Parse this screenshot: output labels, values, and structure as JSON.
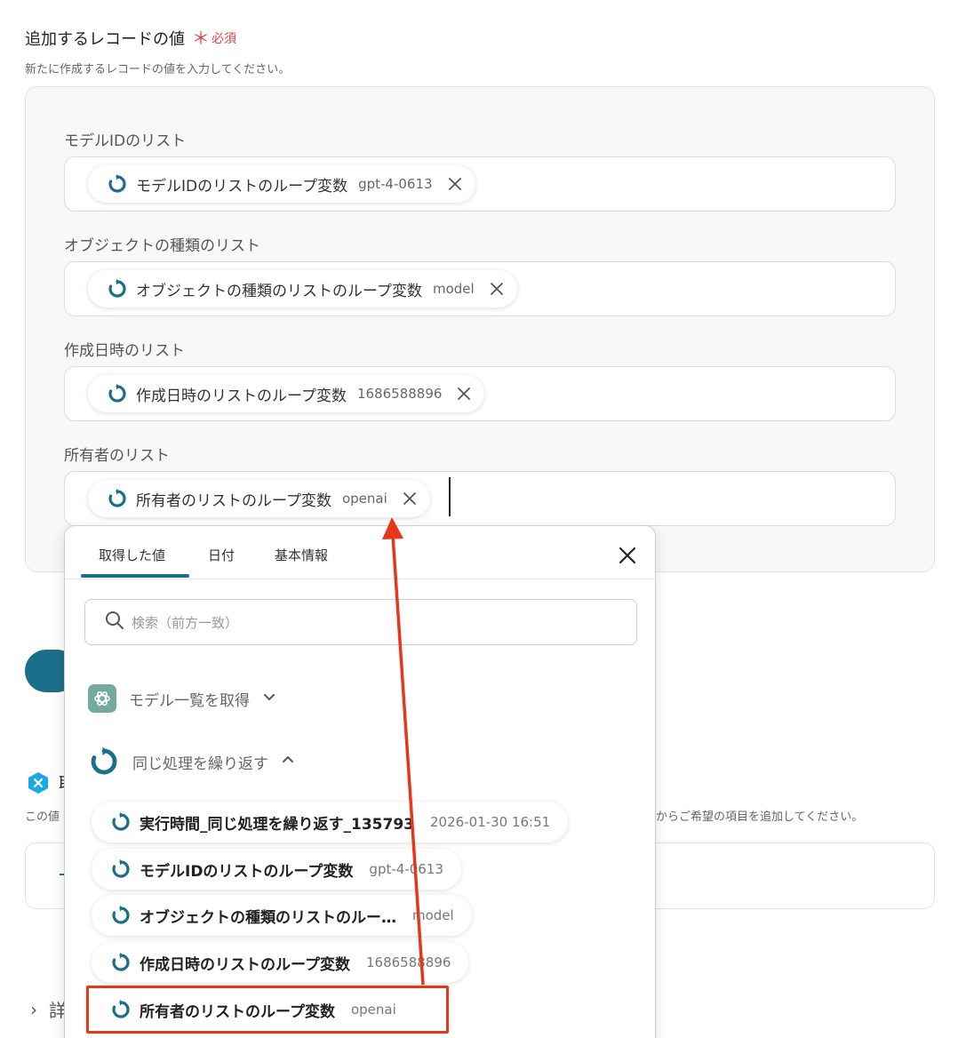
{
  "section": {
    "title": "追加するレコードの値",
    "required_mark": "＊",
    "required_label": "必須",
    "description": "新たに作成するレコードの値を入力してください。"
  },
  "fields": [
    {
      "label": "モデルIDのリスト",
      "chip_label": "モデルIDのリストのループ変数",
      "chip_value": "gpt-4-0613"
    },
    {
      "label": "オブジェクトの種類のリスト",
      "chip_label": "オブジェクトの種類のリストのループ変数",
      "chip_value": "model"
    },
    {
      "label": "作成日時のリスト",
      "chip_label": "作成日時のリストのループ変数",
      "chip_value": "1686588896"
    },
    {
      "label": "所有者のリスト",
      "chip_label": "所有者のリストのループ変数",
      "chip_value": "openai"
    }
  ],
  "background": {
    "title_fragment": "取",
    "desc_left": "この値",
    "desc_right": "からご希望の項目を追加してください。",
    "detail_chevron": "›",
    "detail_fragment": "詳"
  },
  "popup": {
    "tabs": [
      "取得した値",
      "日付",
      "基本情報"
    ],
    "active_tab": 0,
    "search_placeholder": "検索（前方一致）",
    "groups": [
      {
        "name": "モデル一覧を取得",
        "icon": "openai-icon",
        "expanded": false
      },
      {
        "name": "同じ処理を繰り返す",
        "icon": "loop-icon",
        "expanded": true
      }
    ],
    "items": [
      {
        "label": "実行時間_同じ処理を繰り返す_135793",
        "value": "2026-01-30 16:51"
      },
      {
        "label": "モデルIDのリストのループ変数",
        "value": "gpt-4-0613"
      },
      {
        "label": "オブジェクトの種類のリストのルー…",
        "value": "model"
      },
      {
        "label": "作成日時のリストのループ変数",
        "value": "1686588896"
      },
      {
        "label": "所有者のリストのループ変数",
        "value": "openai"
      }
    ]
  },
  "colors": {
    "accent": "#1c6f8b",
    "required": "#e2424d",
    "annotation": "#e8361a",
    "openai": "#74aa9c"
  }
}
